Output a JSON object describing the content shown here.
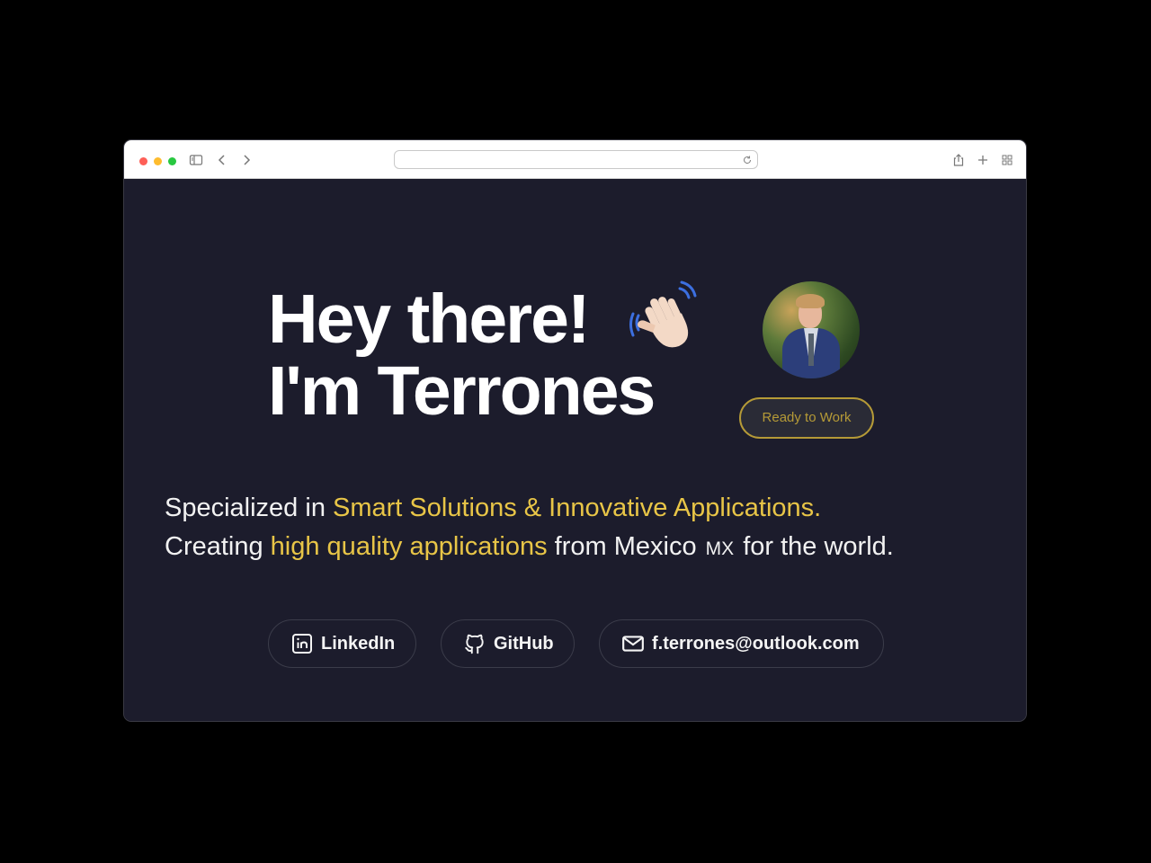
{
  "browser": {
    "url": ""
  },
  "hero": {
    "line1": "Hey there!",
    "line2": "I'm Terrones",
    "wave_emoji": "waving-hand-icon",
    "status_button": "Ready to Work"
  },
  "tagline": {
    "line1_prefix": "Specialized in ",
    "line1_highlight": "Smart Solutions & Innovative Applications.",
    "line2_prefix": "Creating ",
    "line2_highlight": "high quality applications",
    "line2_middle": " from Mexico ",
    "line2_flag": "MX",
    "line2_suffix": " for the world."
  },
  "links": {
    "linkedin": "LinkedIn",
    "github": "GitHub",
    "email": "f.terrones@outlook.com"
  },
  "colors": {
    "background": "#1c1c2c",
    "accent": "#e8c547",
    "button_border": "#b59a37"
  }
}
